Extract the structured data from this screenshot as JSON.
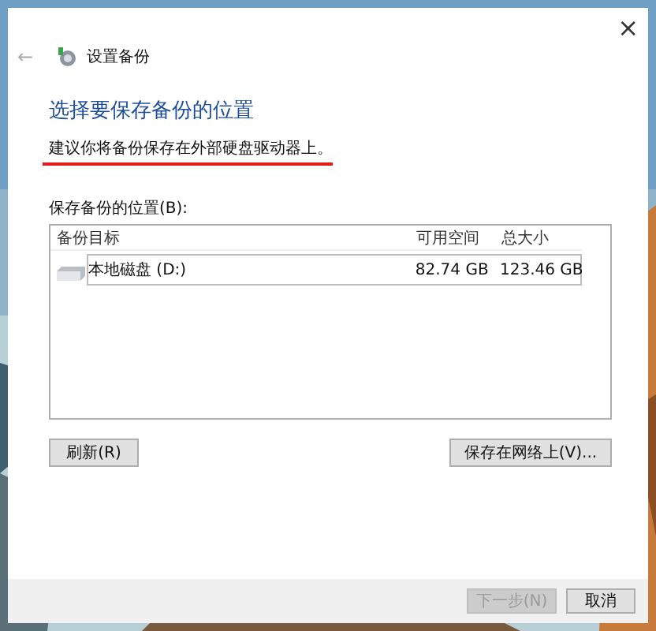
{
  "window": {
    "close": "×",
    "back": "←",
    "title": "设置备份"
  },
  "heading": "选择要保存备份的位置",
  "subtitle": {
    "text": "建议你将备份保存在外部硬盘驱动器上。",
    "underlined": true
  },
  "list_label": "保存备份的位置(B):",
  "table": {
    "columns": [
      "备份目标",
      "可用空间",
      "总大小"
    ],
    "rows": [
      {
        "name": "本地磁盘 (D:)",
        "free": "82.74 GB",
        "total": "123.46 GB",
        "selected": true
      }
    ]
  },
  "buttons": [
    {
      "label": "刷新(R)"
    },
    {
      "label": "保存在网络上(V)..."
    }
  ],
  "footer_buttons": [
    {
      "label": "下一步(N)",
      "disabled": true
    },
    {
      "label": "取消",
      "disabled": false
    }
  ]
}
